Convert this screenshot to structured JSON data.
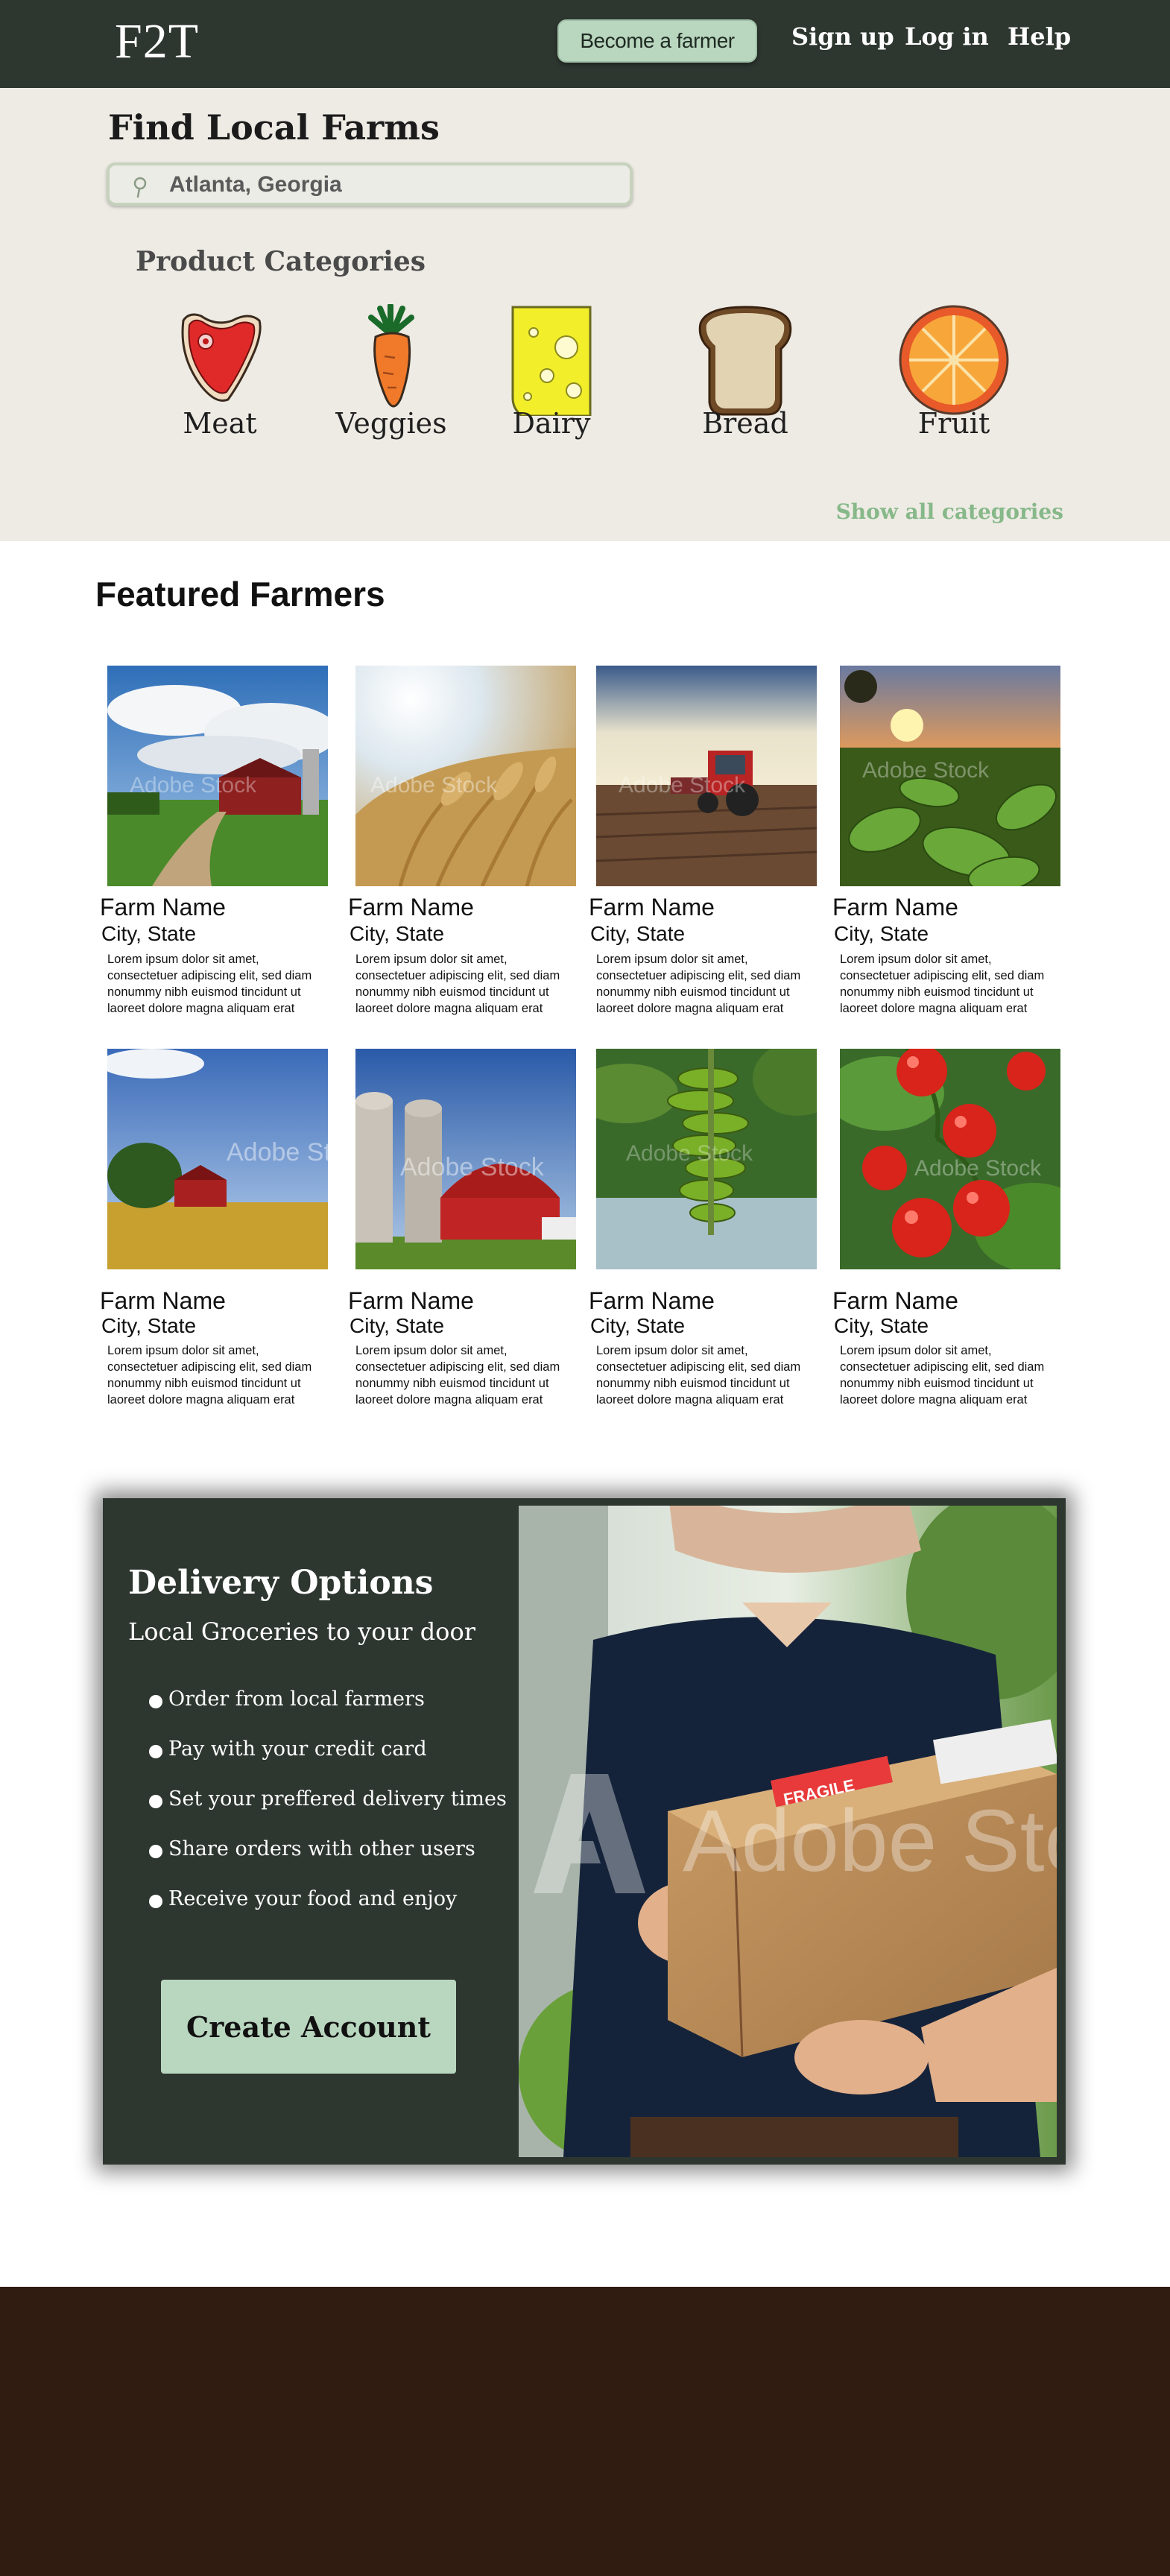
{
  "nav": {
    "logo": "F2T",
    "become_farmer": "Become a farmer",
    "signup": "Sign up",
    "login": "Log in",
    "help": "Help"
  },
  "hero": {
    "title": "Find Local Farms",
    "search_value": "Atlanta, Georgia",
    "categories_heading": "Product Categories",
    "categories": [
      {
        "label": "Meat",
        "icon": "steak-icon"
      },
      {
        "label": "Veggies",
        "icon": "carrot-icon"
      },
      {
        "label": "Dairy",
        "icon": "cheese-icon"
      },
      {
        "label": "Bread",
        "icon": "bread-icon"
      },
      {
        "label": "Fruit",
        "icon": "orange-icon"
      }
    ],
    "show_all": "Show all categories"
  },
  "featured": {
    "title": "Featured Farmers",
    "cards": [
      {
        "name": "Farm Name",
        "city": "City, State",
        "desc": "Lorem ipsum dolor sit amet, consectetuer adipiscing elit, sed diam nonummy nibh euismod tincidunt ut laoreet dolore magna aliquam erat",
        "image": "farm-road-barn-photo"
      },
      {
        "name": "Farm Name",
        "city": "City, State",
        "desc": "Lorem ipsum dolor sit amet, consectetuer adipiscing elit, sed diam nonummy nibh euismod tincidunt ut laoreet dolore magna aliquam erat",
        "image": "wheat-field-photo"
      },
      {
        "name": "Farm Name",
        "city": "City, State",
        "desc": "Lorem ipsum dolor sit amet, consectetuer adipiscing elit, sed diam nonummy nibh euismod tincidunt ut laoreet dolore magna aliquam erat",
        "image": "tractor-photo"
      },
      {
        "name": "Farm Name",
        "city": "City, State",
        "desc": "Lorem ipsum dolor sit amet, consectetuer adipiscing elit, sed diam nonummy nibh euismod tincidunt ut laoreet dolore magna aliquam erat",
        "image": "crop-sunset-photo"
      },
      {
        "name": "Farm Name",
        "city": "City, State",
        "desc": "Lorem ipsum dolor sit amet, consectetuer adipiscing elit, sed diam nonummy nibh euismod tincidunt ut laoreet dolore magna aliquam erat",
        "image": "red-barn-field-photo"
      },
      {
        "name": "Farm Name",
        "city": "City, State",
        "desc": "Lorem ipsum dolor sit amet, consectetuer adipiscing elit, sed diam nonummy nibh euismod tincidunt ut laoreet dolore magna aliquam erat",
        "image": "silo-barn-photo"
      },
      {
        "name": "Farm Name",
        "city": "City, State",
        "desc": "Lorem ipsum dolor sit amet, consectetuer adipiscing elit, sed diam nonummy nibh euismod tincidunt ut laoreet dolore magna aliquam erat",
        "image": "bananas-photo"
      },
      {
        "name": "Farm Name",
        "city": "City, State",
        "desc": "Lorem ipsum dolor sit amet, consectetuer adipiscing elit, sed diam nonummy nibh euismod tincidunt ut laoreet dolore magna aliquam erat",
        "image": "tomatoes-photo"
      }
    ]
  },
  "delivery": {
    "title": "Delivery Options",
    "subtitle": "Local Groceries to your door",
    "items": [
      "Order from local farmers",
      "Pay with your credit card",
      "Set your preffered delivery times",
      "Share orders with other users",
      "Receive your food and enjoy"
    ],
    "cta": "Create Account",
    "photo_watermark": "Adobe Sto",
    "box_label": "FRAGILE"
  },
  "watermark": "Adobe Stock",
  "colors": {
    "nav_bg": "#2e3630",
    "hero_bg": "#edebe4",
    "accent_green": "#b9d6bf",
    "link_green": "#87b889",
    "footer_bg": "#311c12"
  }
}
